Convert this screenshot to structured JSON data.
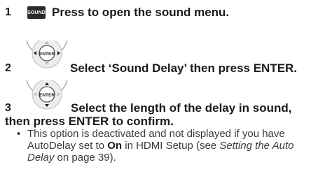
{
  "steps": [
    {
      "number": "1",
      "button_label": "SOUND",
      "text": "Press to open the sound menu."
    },
    {
      "number": "2",
      "button_label": "ENTER",
      "text": "Select ‘Sound Delay’ then press ENTER."
    },
    {
      "number": "3",
      "button_label": "ENTER",
      "text_line1": "Select the length of the delay in sound,",
      "text_line2": "then press ENTER to confirm."
    }
  ],
  "note": {
    "part1": "This option is deactivated and not displayed if you have AutoDelay set to ",
    "on_bold": "On",
    "part2": " in HDMI Setup (see ",
    "link_italic": "Setting the Auto Delay",
    "part3": " on page 39)."
  }
}
